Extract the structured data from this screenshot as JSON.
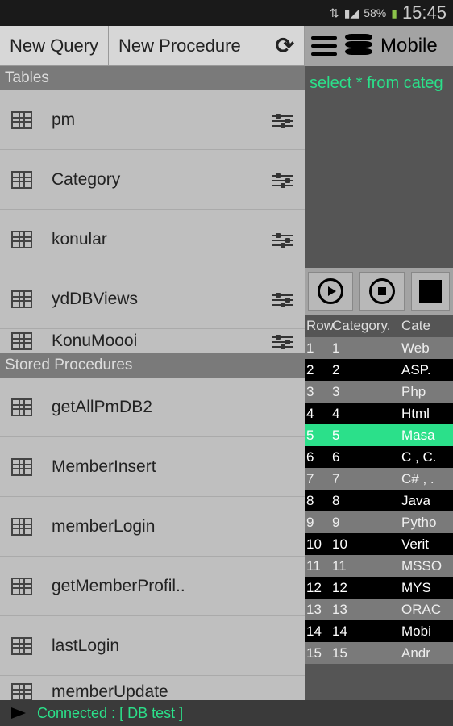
{
  "status": {
    "signal": "58%",
    "time": "15:45"
  },
  "toolbar": {
    "new_query": "New Query",
    "new_procedure": "New Procedure"
  },
  "sections": {
    "tables": "Tables",
    "procs": "Stored Procedures"
  },
  "tables": [
    {
      "name": "pm"
    },
    {
      "name": "Category"
    },
    {
      "name": "konular"
    },
    {
      "name": "ydDBViews"
    },
    {
      "name": "KonuMoooi"
    }
  ],
  "procedures": [
    {
      "name": "getAllPmDB2"
    },
    {
      "name": "MemberInsert"
    },
    {
      "name": "memberLogin"
    },
    {
      "name": "getMemberProfil.."
    },
    {
      "name": "lastLogin"
    },
    {
      "name": "memberUpdate"
    }
  ],
  "right": {
    "title": "Mobile",
    "query": "select * from categ"
  },
  "grid": {
    "headers": {
      "row": "Row",
      "col1": "Category.",
      "col2": "Cate"
    },
    "rows": [
      {
        "row": "1",
        "cat": "1",
        "val": "Web",
        "sel": false,
        "odd": true
      },
      {
        "row": "2",
        "cat": "2",
        "val": "ASP.",
        "sel": false,
        "odd": false
      },
      {
        "row": "3",
        "cat": "3",
        "val": "Php",
        "sel": false,
        "odd": true
      },
      {
        "row": "4",
        "cat": "4",
        "val": "Html",
        "sel": false,
        "odd": false
      },
      {
        "row": "5",
        "cat": "5",
        "val": "Masa",
        "sel": true,
        "odd": true
      },
      {
        "row": "6",
        "cat": "6",
        "val": "C , C.",
        "sel": false,
        "odd": false
      },
      {
        "row": "7",
        "cat": "7",
        "val": "C# , .",
        "sel": false,
        "odd": true
      },
      {
        "row": "8",
        "cat": "8",
        "val": "Java",
        "sel": false,
        "odd": false
      },
      {
        "row": "9",
        "cat": "9",
        "val": "Pytho",
        "sel": false,
        "odd": true
      },
      {
        "row": "10",
        "cat": "10",
        "val": "Verit",
        "sel": false,
        "odd": false
      },
      {
        "row": "11",
        "cat": "11",
        "val": "MSSO",
        "sel": false,
        "odd": true
      },
      {
        "row": "12",
        "cat": "12",
        "val": "MYS",
        "sel": false,
        "odd": false
      },
      {
        "row": "13",
        "cat": "13",
        "val": "ORAC",
        "sel": false,
        "odd": true
      },
      {
        "row": "14",
        "cat": "14",
        "val": "Mobi",
        "sel": false,
        "odd": false
      },
      {
        "row": "15",
        "cat": "15",
        "val": "Andr",
        "sel": false,
        "odd": true
      }
    ]
  },
  "footer": {
    "status": "Connected : [   DB  test       ]"
  }
}
